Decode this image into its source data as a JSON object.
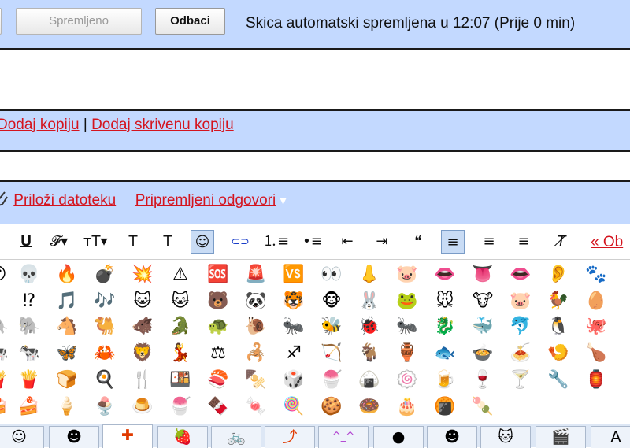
{
  "header": {
    "saved_label": "Spremljeno",
    "discard_label": "Odbaci",
    "status": "Skica automatski spremljena u 12:07 (Prije 0 min)"
  },
  "recipients": {
    "add_cc": "Dodaj kopiju",
    "separator": "|",
    "add_bcc": "Dodaj skrivenu kopiju"
  },
  "attachments": {
    "attach_file": "Priloži datoteku",
    "canned_responses": "Pripremljeni odgovori",
    "canned_arrow": "▾"
  },
  "toolbar": {
    "items": [
      {
        "name": "underline-button",
        "glyph": "U"
      },
      {
        "name": "font-button",
        "glyph": "𝓕▾"
      },
      {
        "name": "font-size-button",
        "glyph": "тT▾"
      },
      {
        "name": "text-color-button",
        "glyph": "T"
      },
      {
        "name": "highlight-button",
        "glyph": "T"
      },
      {
        "name": "emoji-button",
        "glyph": "☺"
      },
      {
        "name": "link-button",
        "glyph": "⊂⊃"
      },
      {
        "name": "numbered-list-button",
        "glyph": "⒈≡"
      },
      {
        "name": "bulleted-list-button",
        "glyph": "•≡"
      },
      {
        "name": "outdent-button",
        "glyph": "⇤"
      },
      {
        "name": "indent-button",
        "glyph": "⇥"
      },
      {
        "name": "quote-button",
        "glyph": "❝"
      },
      {
        "name": "align-left-button",
        "glyph": "≡"
      },
      {
        "name": "align-center-button",
        "glyph": "≡"
      },
      {
        "name": "align-right-button",
        "glyph": "≡"
      },
      {
        "name": "remove-format-button",
        "glyph": "T̸"
      }
    ],
    "more_label": "« Ob"
  },
  "emoji_rows": [
    [
      "😶",
      "💀",
      "🔥",
      "💣",
      "💥",
      "⚠",
      "🆘",
      "🚨",
      "🆚",
      "👀",
      "👃",
      "🐷",
      "👄",
      "👅",
      "👄",
      "👂",
      "🐾"
    ],
    [
      "❗",
      "⁉",
      "🎵",
      "🎶",
      "🐱",
      "🐱",
      "🐻",
      "🐼",
      "🐯",
      "🐵",
      "🐰",
      "🐸",
      "🐭",
      "🐮",
      "🐷",
      "🐓",
      "🥚"
    ],
    [
      "🐘",
      "🐘",
      "🐴",
      "🐫",
      "🐗",
      "🐊",
      "🐢",
      "🐌",
      "🐜",
      "🐝",
      "🐞",
      "🐜",
      "🐉",
      "🐳",
      "🐬",
      "🐧",
      "🐙"
    ],
    [
      "🐄",
      "🐄",
      "🦋",
      "🦀",
      "🦁",
      "💃",
      "⚖",
      "🦂",
      "♐",
      "🏹",
      "🐐",
      "🏺",
      "🐟",
      "🍲",
      "🍝",
      "🍤",
      "🍗"
    ],
    [
      "🍟",
      "🍟",
      "🍞",
      "🍳",
      "🍴",
      "🍱",
      "🍣",
      "🍢",
      "🎲",
      "🍧",
      "🍙",
      "🍥",
      "🍺",
      "🍷",
      "🍸",
      "🔧",
      "🏮"
    ],
    [
      "🍰",
      "🍰",
      "🍦",
      "🍨",
      "🍮",
      "🍧",
      "🍫",
      "🍬",
      "🍭",
      "🍪",
      "🍩",
      "🎂",
      "🍘",
      "🍡"
    ]
  ],
  "tabs": [
    {
      "name": "tab-smileys",
      "glyph": "☺"
    },
    {
      "name": "tab-faces",
      "glyph": "☻"
    },
    {
      "name": "tab-symbols",
      "glyph": "✚"
    },
    {
      "name": "tab-food",
      "glyph": "🍓"
    },
    {
      "name": "tab-transport",
      "glyph": "🚲"
    },
    {
      "name": "tab-arrows",
      "glyph": "⤴"
    },
    {
      "name": "tab-kaomoji",
      "glyph": "^_^"
    },
    {
      "name": "tab-circle",
      "glyph": "●"
    },
    {
      "name": "tab-emoticons",
      "glyph": "☻"
    },
    {
      "name": "tab-cat",
      "glyph": "🐱"
    },
    {
      "name": "tab-clapper",
      "glyph": "🎬"
    },
    {
      "name": "tab-text",
      "glyph": "A"
    }
  ]
}
